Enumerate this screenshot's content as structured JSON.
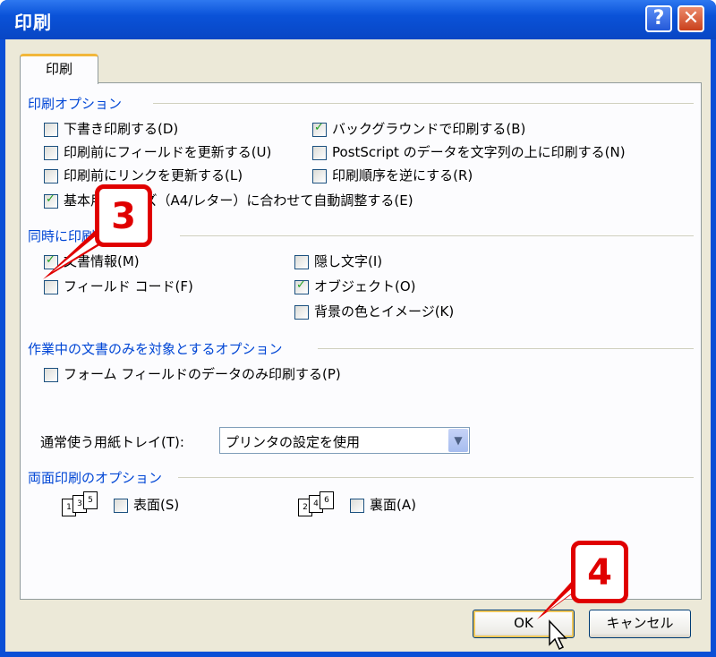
{
  "window": {
    "title": "印刷",
    "help_glyph": "?",
    "close_glyph": "✕"
  },
  "tab": {
    "label": "印刷"
  },
  "print_options": {
    "title": "印刷オプション",
    "items": [
      {
        "label": "下書き印刷する(D)",
        "checked": false
      },
      {
        "label": "印刷前にフィールドを更新する(U)",
        "checked": false
      },
      {
        "label": "印刷前にリンクを更新する(L)",
        "checked": false
      },
      {
        "label": "基本用紙サイズ（A4/レター）に合わせて自動調整する(E)",
        "checked": true
      },
      {
        "label": "バックグラウンドで印刷する(B)",
        "checked": true
      },
      {
        "label": "PostScript のデータを文字列の上に印刷する(N)",
        "checked": false
      },
      {
        "label": "印刷順序を逆にする(R)",
        "checked": false
      }
    ]
  },
  "include_options": {
    "title": "同時に印刷する項目",
    "items": [
      {
        "label": "文書情報(M)",
        "checked": true
      },
      {
        "label": "フィールド コード(F)",
        "checked": false
      },
      {
        "label": "隠し文字(I)",
        "checked": false
      },
      {
        "label": "オブジェクト(O)",
        "checked": true
      },
      {
        "label": "背景の色とイメージ(K)",
        "checked": false
      }
    ]
  },
  "current_doc_options": {
    "title": "作業中の文書のみを対象とするオプション",
    "items": [
      {
        "label": "フォーム フィールドのデータのみ印刷する(P)",
        "checked": false
      }
    ]
  },
  "tray": {
    "label": "通常使う用紙トレイ(T):",
    "value": "プリンタの設定を使用"
  },
  "duplex": {
    "title": "両面印刷のオプション",
    "front": {
      "label": "表面(S)",
      "checked": false
    },
    "back": {
      "label": "裏面(A)",
      "checked": false
    }
  },
  "buttons": {
    "ok": "OK",
    "cancel": "キャンセル"
  },
  "callouts": {
    "step3": "3",
    "step4": "4"
  },
  "colors": {
    "accent_red": "#e00000",
    "group_title": "#0046d5",
    "titlebar": "#0a52d8"
  }
}
